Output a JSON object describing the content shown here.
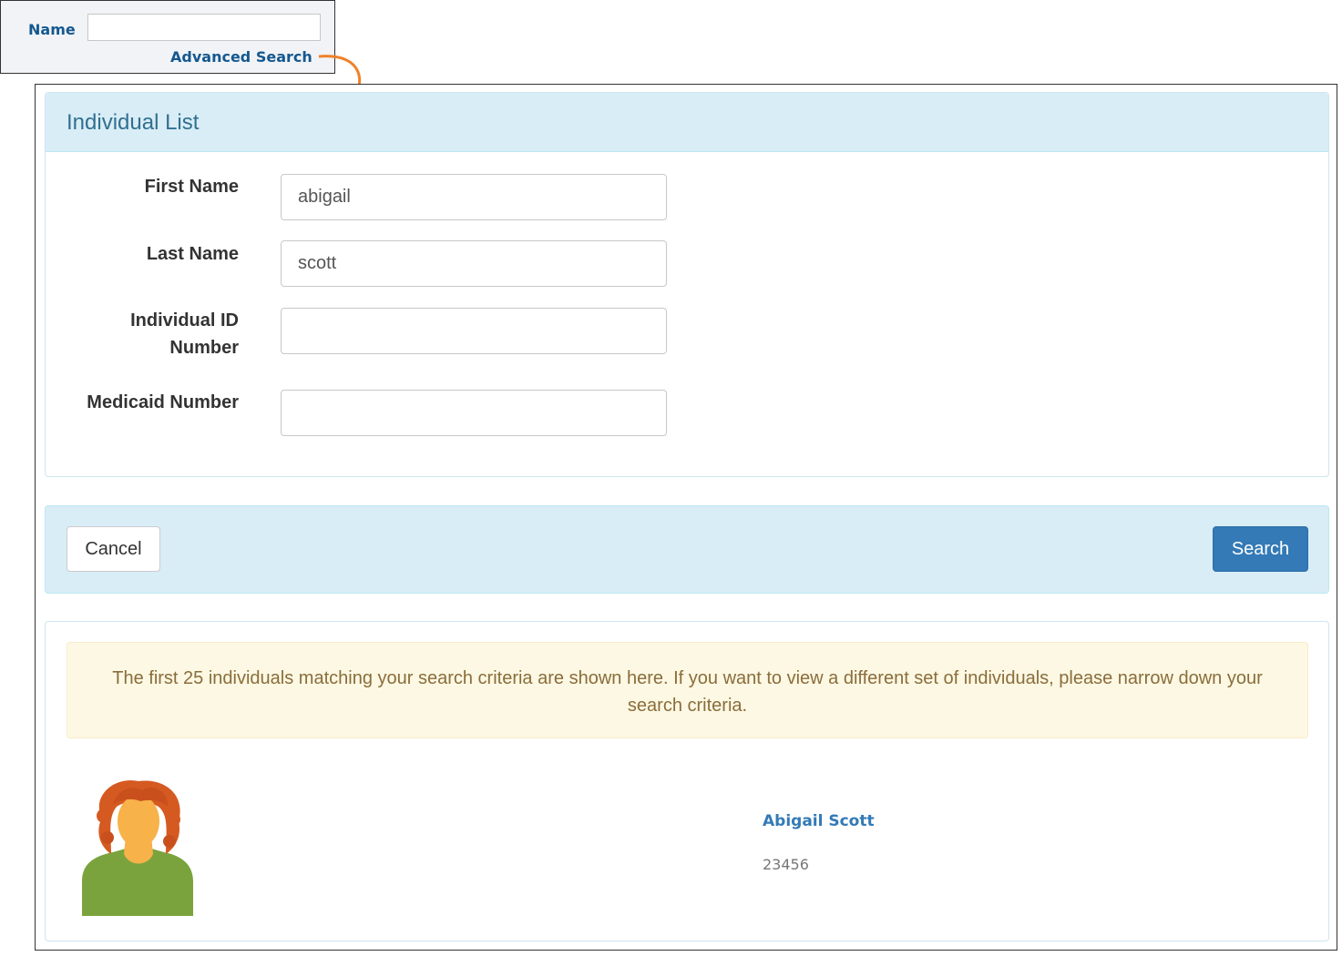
{
  "quick_search": {
    "name_label": "Name",
    "name_value": "",
    "advanced_link": "Advanced Search"
  },
  "form": {
    "title": "Individual List",
    "fields": [
      {
        "label": "First Name",
        "value": "abigail"
      },
      {
        "label": "Last Name",
        "value": "scott"
      },
      {
        "label_line1": "Individual ID",
        "label_line2": "Number",
        "value": ""
      },
      {
        "label": "Medicaid Number",
        "value": ""
      }
    ]
  },
  "actions": {
    "cancel_label": "Cancel",
    "search_label": "Search"
  },
  "results": {
    "notice": "The first 25 individuals matching your search criteria are shown here. If you want to view a different set of individuals, please narrow down your search criteria.",
    "items": [
      {
        "name": "Abigail Scott",
        "id": "23456",
        "avatar": "female-avatar-icon"
      }
    ]
  },
  "colors": {
    "accent": "#337ab7",
    "panel_header": "#d9edf7",
    "title_text": "#31708f",
    "notice_bg": "#fcf8e3",
    "annotation_arrow": "#f0812a"
  }
}
